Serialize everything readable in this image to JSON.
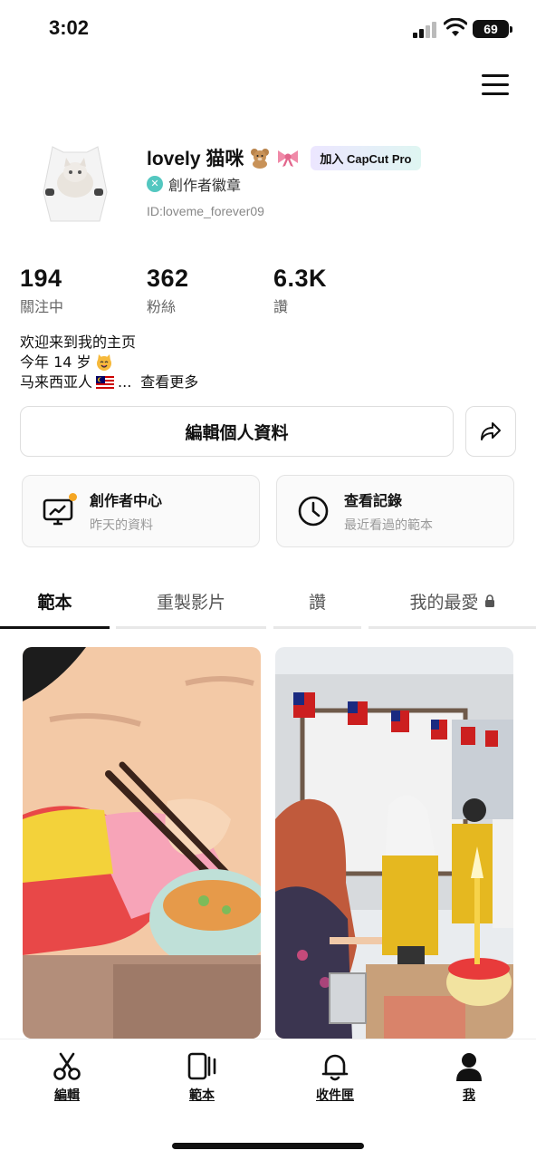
{
  "status_bar": {
    "time": "3:02",
    "battery": "69"
  },
  "profile": {
    "name": "lovely 猫咪",
    "pro_badge": "加入 CapCut Pro",
    "creator_badge": "創作者徽章",
    "user_id": "ID:loveme_forever09"
  },
  "stats": [
    {
      "value": "194",
      "label": "關注中"
    },
    {
      "value": "362",
      "label": "粉絲"
    },
    {
      "value": "6.3K",
      "label": "讚"
    }
  ],
  "bio": {
    "line1": "欢迎来到我的主页",
    "line2": "今年 14 岁",
    "line3": "马来西亚人",
    "ellipsis": "...",
    "see_more": "查看更多"
  },
  "actions": {
    "edit_profile": "編輯個人資料"
  },
  "cards": [
    {
      "title": "創作者中心",
      "subtitle": "昨天的資料"
    },
    {
      "title": "查看記錄",
      "subtitle": "最近看過的範本"
    }
  ],
  "tabs": [
    "範本",
    "重製影片",
    "讚",
    "我的最愛"
  ],
  "bottom_nav": [
    "編輯",
    "範本",
    "收件匣",
    "我"
  ],
  "colors": {
    "accent": "#53c7c0",
    "notification_dot": "#f5a623"
  }
}
